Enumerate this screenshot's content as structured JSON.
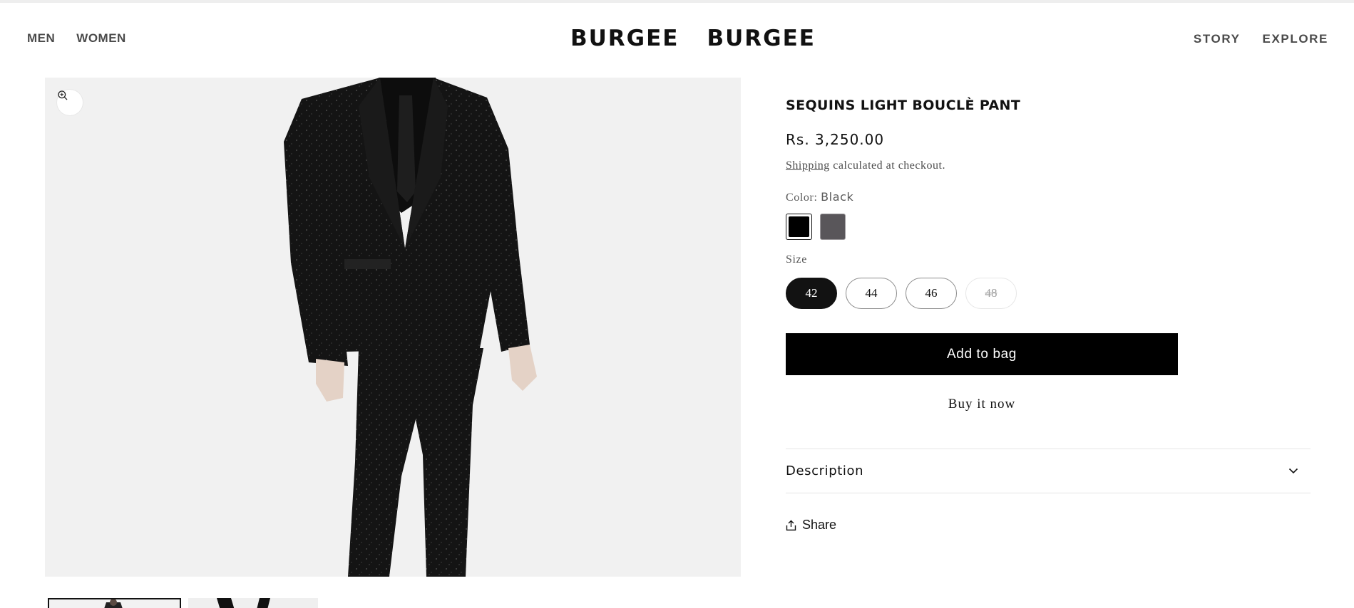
{
  "header": {
    "nav_left": [
      "MEN",
      "WOMEN"
    ],
    "logo_words": [
      "BURGEE",
      "BURGEE"
    ],
    "nav_right": [
      "STORY",
      "EXPLORE"
    ]
  },
  "gallery": {
    "zoom_icon": "zoom-in-icon",
    "thumbnails": 2
  },
  "product": {
    "title": "SEQUINS LIGHT BOUCLÈ PANT",
    "price": "Rs. 3,250.00",
    "shipping_link": "Shipping",
    "shipping_rest": " calculated at checkout.",
    "color_label": "Color:",
    "color_value": "Black",
    "swatches": [
      {
        "name": "Black",
        "color": "#000000",
        "selected": true
      },
      {
        "name": "Grey",
        "color": "#59565a",
        "selected": false
      }
    ],
    "size_label": "Size",
    "sizes": [
      "42",
      "44",
      "46",
      "48"
    ],
    "selected_size": "42",
    "sold_out_size": "48",
    "add_to_bag": "Add to bag",
    "buy_now": "Buy it now",
    "description_label": "Description",
    "share_label": "Share"
  },
  "colors": {
    "text": "#121212",
    "button": "#000000",
    "image_bg": "#f1f1f1"
  }
}
